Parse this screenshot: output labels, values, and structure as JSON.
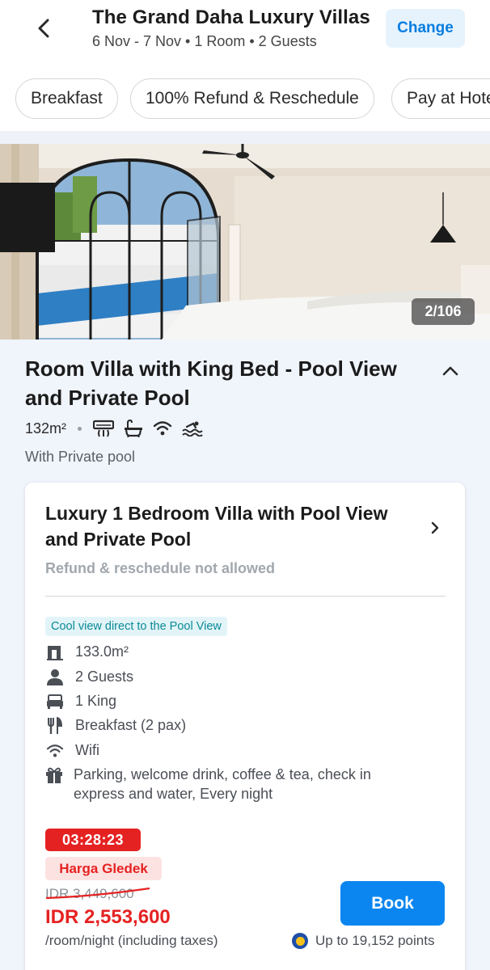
{
  "header": {
    "title": "The Grand Daha Luxury Villas",
    "subtitle": "6 Nov - 7 Nov • 1 Room • 2 Guests",
    "change_label": "Change"
  },
  "filters": [
    "Breakfast",
    "100% Refund & Reschedule",
    "Pay at Hotel"
  ],
  "photo": {
    "counter": "2/106"
  },
  "room": {
    "title": "Room Villa with King Bed - Pool View and Private Pool",
    "area": "132m²",
    "facility_icons": [
      "air-conditioner-icon",
      "bathtub-icon",
      "wifi-icon",
      "pool-icon"
    ],
    "feature": "With Private pool"
  },
  "offer": {
    "title": "Luxury 1 Bedroom Villa with Pool View and Private Pool",
    "refund_note": "Refund & reschedule not allowed",
    "tag": "Cool view direct to the Pool View",
    "features": [
      {
        "icon": "room-size-icon",
        "text": "133.0m²"
      },
      {
        "icon": "guests-icon",
        "text": "2 Guests"
      },
      {
        "icon": "bed-icon",
        "text": "1 King"
      },
      {
        "icon": "breakfast-icon",
        "text": "Breakfast (2 pax)"
      },
      {
        "icon": "wifi-icon",
        "text": "Wifi"
      },
      {
        "icon": "gift-icon",
        "text": "Parking, welcome drink, coffee & tea, check in express and water, Every night"
      }
    ],
    "timer": "03:28:23",
    "promo_label": "Harga Gledek",
    "original_price": "IDR 3,449,600",
    "price": "IDR 2,553,600",
    "price_note": "/room/night (including taxes)",
    "book_label": "Book",
    "points": "Up to 19,152 points"
  },
  "colors": {
    "accent": "#0b86f0",
    "sale_red": "#e52222",
    "tag_teal": "#0b8a97",
    "page_bg": "#f0f4fb"
  }
}
